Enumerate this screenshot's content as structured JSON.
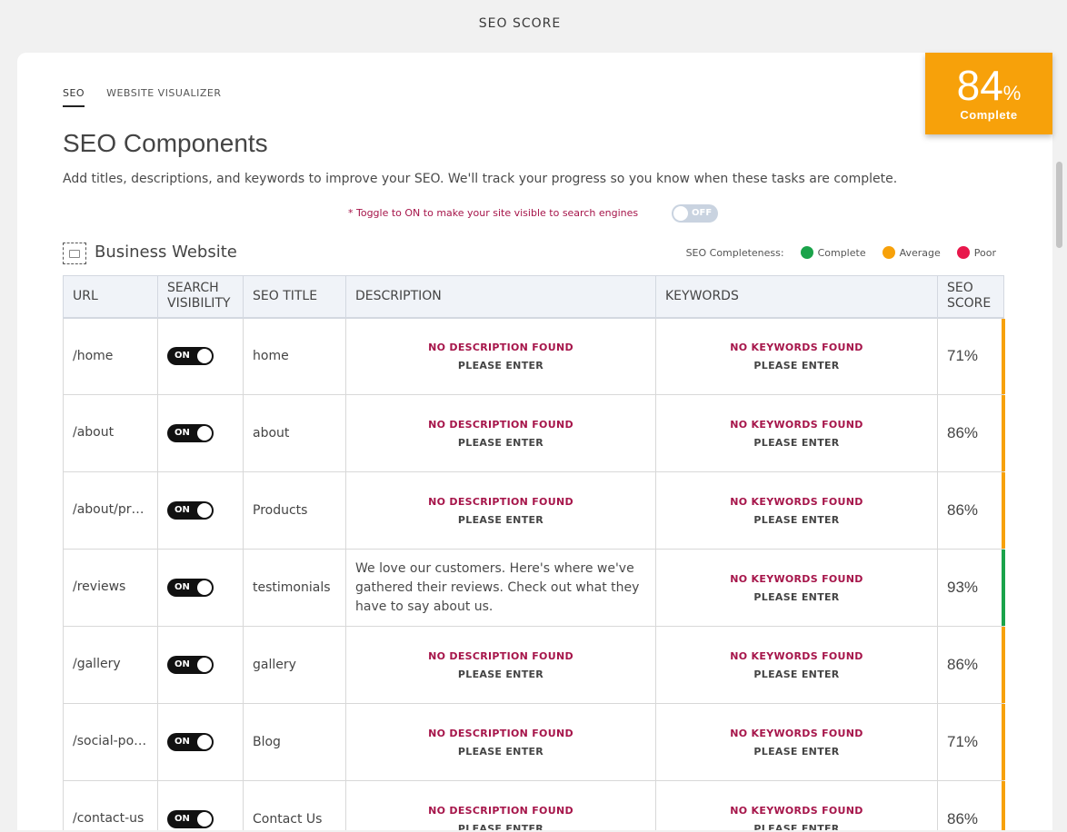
{
  "page_title": "SEO SCORE",
  "badge": {
    "value": "84",
    "unit": "%",
    "label": "Complete"
  },
  "tabs": [
    {
      "label": "SEO",
      "active": true
    },
    {
      "label": "WEBSITE VISUALIZER",
      "active": false
    }
  ],
  "heading": "SEO Components",
  "intro": "Add titles, descriptions, and keywords to improve your SEO. We'll track your progress so you know when these tasks are complete.",
  "visibility_note": "* Toggle to ON to make your site visible to search engines",
  "visibility_toggle": "OFF",
  "site_name": "Business Website",
  "legend": {
    "title": "SEO Completeness:",
    "items": [
      {
        "label": "Complete",
        "color": "#1aa34a"
      },
      {
        "label": "Average",
        "color": "#f7a10a"
      },
      {
        "label": "Poor",
        "color": "#e8174b"
      }
    ]
  },
  "columns": [
    "URL",
    "SEARCH VISIBILITY",
    "SEO TITLE",
    "DESCRIPTION",
    "KEYWORDS",
    "SEO SCORE"
  ],
  "missing": {
    "description": "NO DESCRIPTION FOUND",
    "keywords": "NO KEYWORDS FOUND",
    "enter": "PLEASE ENTER"
  },
  "rows": [
    {
      "url": "/home",
      "visibility": "ON",
      "title": "home",
      "description": null,
      "keywords": null,
      "score": "71%",
      "status_color": "#f7a10a"
    },
    {
      "url": "/about",
      "visibility": "ON",
      "title": "about",
      "description": null,
      "keywords": null,
      "score": "86%",
      "status_color": "#f7a10a"
    },
    {
      "url": "/about/pr…",
      "visibility": "ON",
      "title": "Products",
      "description": null,
      "keywords": null,
      "score": "86%",
      "status_color": "#f7a10a"
    },
    {
      "url": "/reviews",
      "visibility": "ON",
      "title": "testimonials",
      "description": "We love our customers. Here's where we've gathered their reviews. Check out what they have to say about us.",
      "keywords": null,
      "score": "93%",
      "status_color": "#1aa34a"
    },
    {
      "url": "/gallery",
      "visibility": "ON",
      "title": "gallery",
      "description": null,
      "keywords": null,
      "score": "86%",
      "status_color": "#f7a10a"
    },
    {
      "url": "/social-po…",
      "visibility": "ON",
      "title": "Blog",
      "description": null,
      "keywords": null,
      "score": "71%",
      "status_color": "#f7a10a"
    },
    {
      "url": "/contact-us",
      "visibility": "ON",
      "title": "Contact Us",
      "description": null,
      "keywords": null,
      "score": "86%",
      "status_color": "#f7a10a"
    }
  ]
}
